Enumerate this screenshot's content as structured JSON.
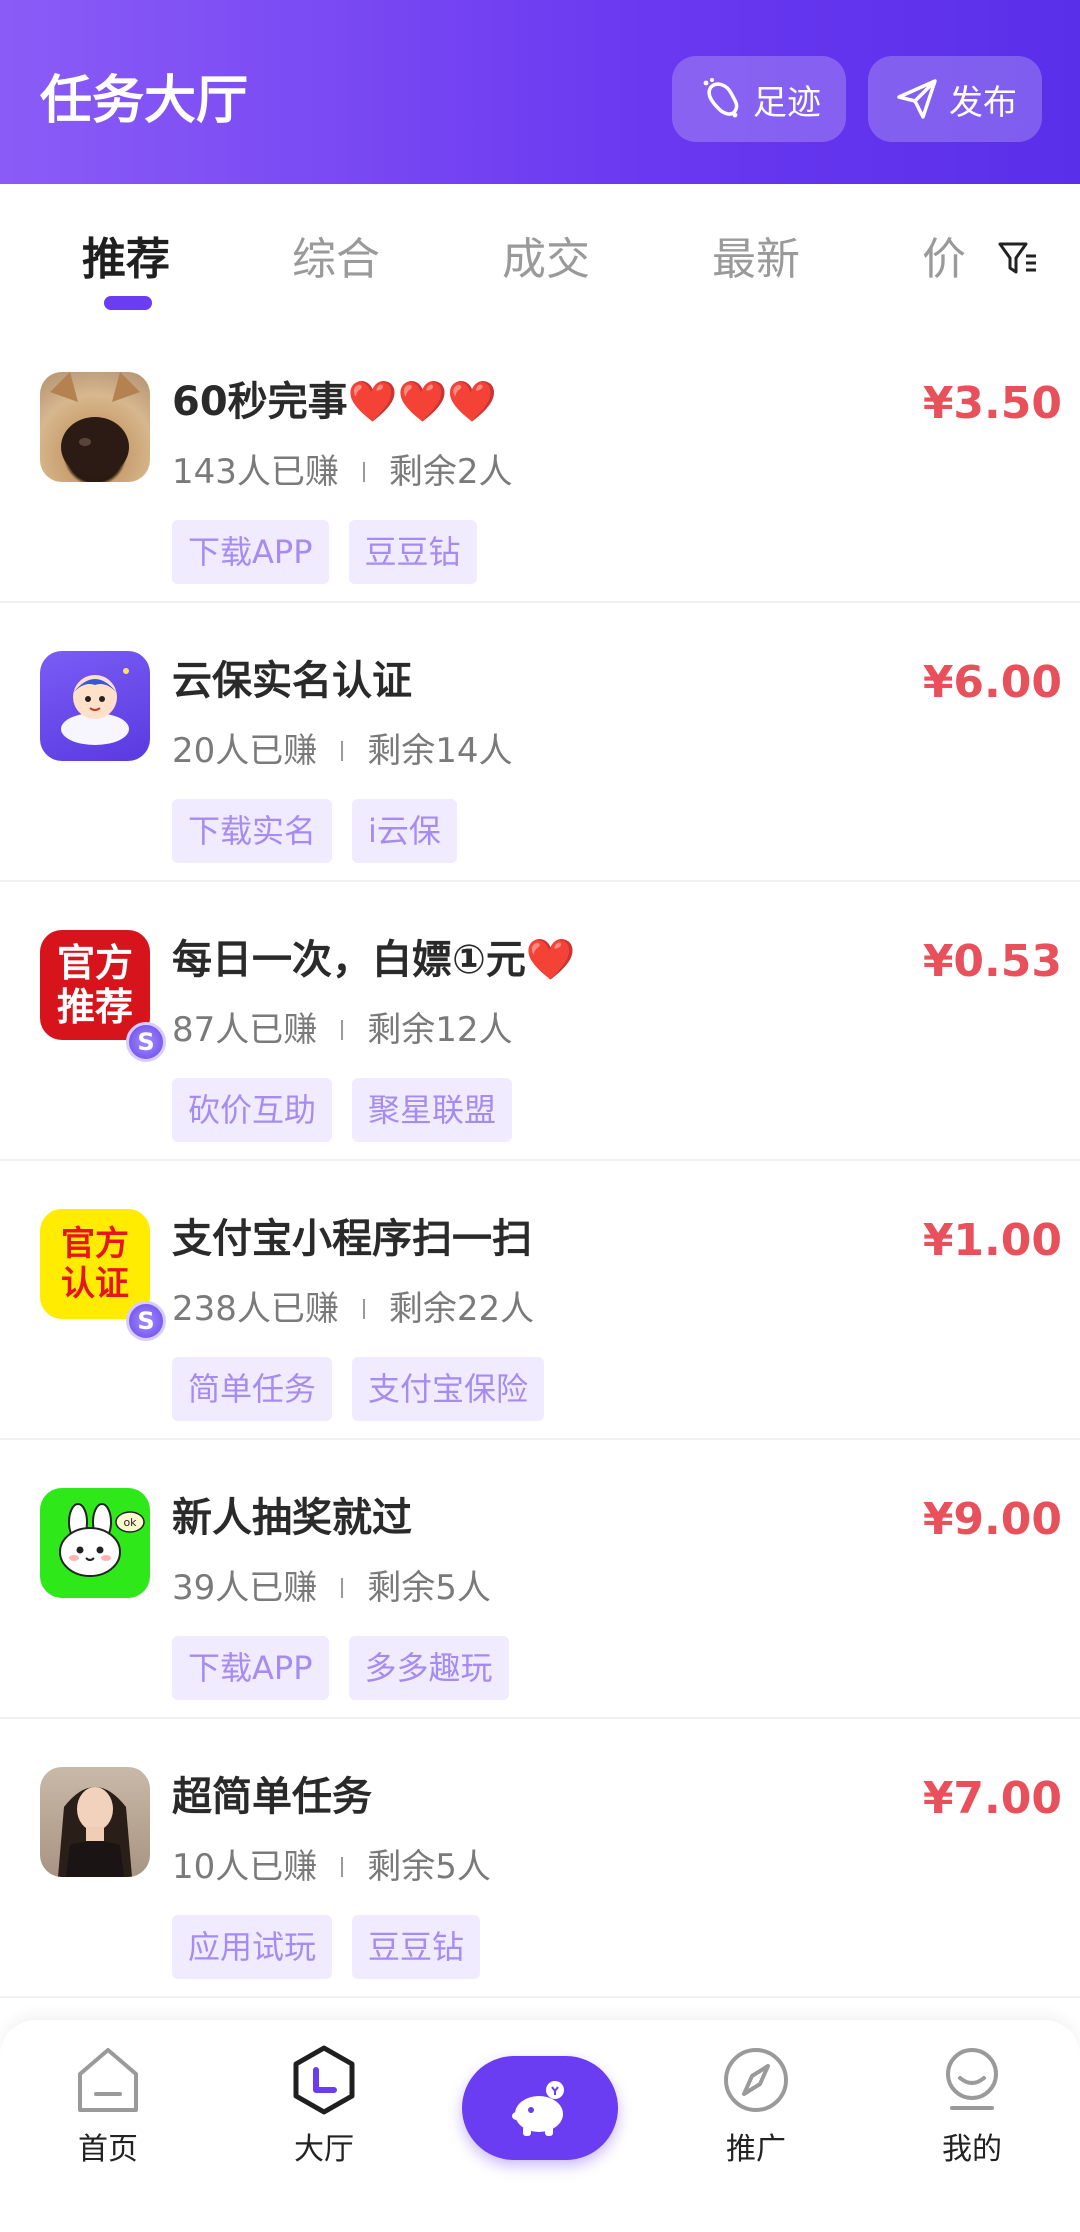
{
  "header": {
    "title": "任务大厅",
    "footprint_label": "足迹",
    "publish_label": "发布"
  },
  "tabs": [
    "推荐",
    "综合",
    "成交",
    "最新",
    "价"
  ],
  "tasks": [
    {
      "title": "60秒完事",
      "hearts": "❤️❤️❤️",
      "earned": "143人已赚",
      "remaining": "剩余2人",
      "tags": [
        "下载APP",
        "豆豆钻"
      ],
      "price": "¥3.50",
      "avatar": "dog-photo",
      "badge": ""
    },
    {
      "title": "云保实名认证",
      "hearts": "",
      "earned": "20人已赚",
      "remaining": "剩余14人",
      "tags": [
        "下载实名",
        "i云保"
      ],
      "price": "¥6.00",
      "avatar": "app-cartoon",
      "badge": ""
    },
    {
      "title": "每日一次，白嫖①元",
      "hearts": "❤️",
      "earned": "87人已赚",
      "remaining": "剩余12人",
      "tags": [
        "砍价互助",
        "聚星联盟"
      ],
      "price": "¥0.53",
      "avatar": "official-recommend",
      "badge": "S",
      "avatar_text_top": "官方",
      "avatar_text_bottom": "推荐"
    },
    {
      "title": "支付宝小程序扫一扫",
      "hearts": "",
      "earned": "238人已赚",
      "remaining": "剩余22人",
      "tags": [
        "简单任务",
        "支付宝保险"
      ],
      "price": "¥1.00",
      "avatar": "official-certify",
      "badge": "S",
      "avatar_text_top": "官方",
      "avatar_text_bottom": "认证"
    },
    {
      "title": "新人抽奖就过",
      "hearts": "",
      "earned": "39人已赚",
      "remaining": "剩余5人",
      "tags": [
        "下载APP",
        "多多趣玩"
      ],
      "price": "¥9.00",
      "avatar": "bunny-green",
      "badge": "",
      "avatar_bubble": "ok"
    },
    {
      "title": "超简单任务",
      "hearts": "",
      "earned": "10人已赚",
      "remaining": "剩余5人",
      "tags": [
        "应用试玩",
        "豆豆钻"
      ],
      "price": "¥7.00",
      "avatar": "woman-photo",
      "badge": ""
    }
  ],
  "nav": {
    "home": "首页",
    "hall": "大厅",
    "promote": "推广",
    "mine": "我的"
  },
  "colors": {
    "primary": "#6a3cf2",
    "price": "#e8505b",
    "tag_bg": "#f0ebff",
    "tag_text": "#a68cf0"
  }
}
